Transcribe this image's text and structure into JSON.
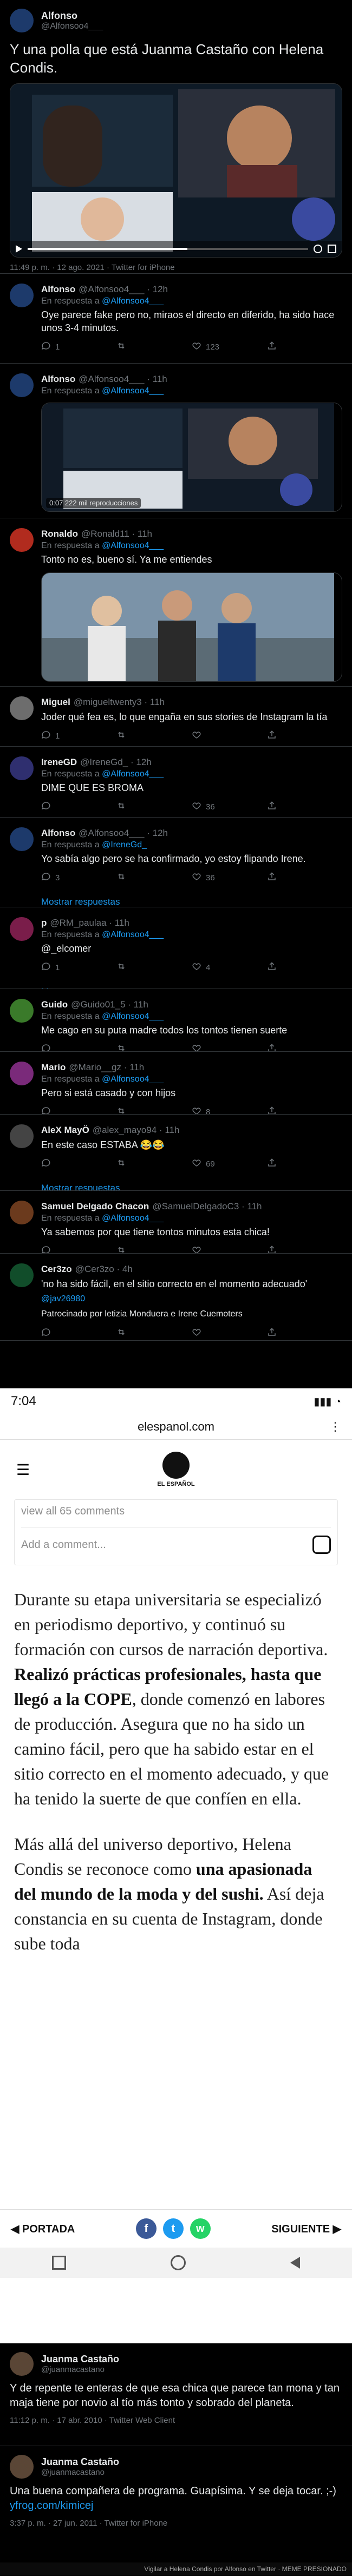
{
  "tweet_main": {
    "name": "Alfonso",
    "handle": "@Alfonsoo4___",
    "text": "Y una polla que está Juanma Castaño con Helena Condis.",
    "meta": "11:49 p. m. · 12 ago. 2021 · Twitter for iPhone",
    "video_progress": 0.57
  },
  "replies": [
    {
      "name": "Alfonso",
      "handle": "@Alfonsoo4___",
      "time": "12h",
      "reply_to": "@Alfonsoo4___",
      "text": "Oye parece fake pero no, miraos el directo en diferido, ha sido hace unos 3-4 minutos.",
      "comments": "1",
      "retweets": "",
      "likes": "123",
      "av": "#1d3a6b"
    },
    {
      "name": "Alfonso",
      "handle": "@Alfonsoo4___",
      "time": "11h",
      "reply_to": "@Alfonsoo4___",
      "text": "",
      "video_caption": "0:07   222 mil reproducciones",
      "comments": "",
      "retweets": "",
      "likes": "",
      "av": "#1d3a6b"
    },
    {
      "name": "Ronaldo",
      "handle": "@Ronald11",
      "time": "11h",
      "reply_to": "@Alfonsoo4___",
      "text": "Tonto no es, bueno sí. Ya me entiendes",
      "comments": "3",
      "retweets": "1",
      "likes": "40",
      "av": "#b12b1e"
    },
    {
      "name": "Miguel",
      "handle": "@migueltwenty3",
      "time": "11h",
      "reply_to": "",
      "text": "Joder qué fea es, lo que engaña en sus stories de Instagram la tía",
      "comments": "1",
      "retweets": "",
      "likes": "",
      "av": "#6d6d6d"
    },
    {
      "name": "IreneGD",
      "handle": "@IreneGd_",
      "time": "12h",
      "reply_to": "@Alfonsoo4___",
      "text": "DIME QUE ES BROMA",
      "comments": "",
      "retweets": "",
      "likes": "36",
      "av": "#2f2f6f"
    },
    {
      "name": "Alfonso",
      "handle": "@Alfonsoo4___",
      "time": "12h",
      "reply_to": "@IreneGd_",
      "text": "Yo sabía algo pero se ha confirmado, yo estoy flipando Irene.",
      "comments": "3",
      "retweets": "",
      "likes": "36",
      "av": "#1d3a6b",
      "show": "Mostrar respuestas"
    },
    {
      "name": "p",
      "handle": "@RM_paulaa",
      "time": "11h",
      "reply_to": "@Alfonsoo4___",
      "text": "@_elcomer",
      "comments": "1",
      "retweets": "",
      "likes": "4",
      "av": "#7a1d4a",
      "show": "Mostrar respuestas"
    },
    {
      "name": "Guido",
      "handle": "@Guido01_5",
      "time": "11h",
      "reply_to": "@Alfonsoo4___",
      "text": "Me cago en su puta madre todos los tontos tienen suerte",
      "comments": "",
      "retweets": "",
      "likes": "",
      "av": "#3a7a2a"
    },
    {
      "name": "Mario",
      "handle": "@Mario__gz",
      "time": "11h",
      "reply_to": "@Alfonsoo4___",
      "text": "Pero si está casado y con hijos",
      "comments": "",
      "retweets": "",
      "likes": "8",
      "av": "#7a2a7a"
    },
    {
      "name": "AleX MayÖ",
      "handle": "@alex_mayo94",
      "time": "11h",
      "reply_to": "",
      "text": "En este caso ESTABA 😂😂",
      "comments": "",
      "retweets": "",
      "likes": "69",
      "av": "#444",
      "show": "Mostrar respuestas"
    },
    {
      "name": "Samuel Delgado Chacon",
      "handle": "@SamuelDelgadoC3",
      "time": "11h",
      "reply_to": "@Alfonsoo4___",
      "text": "Ya sabemos por que tiene tontos minutos esta chica!",
      "comments": "",
      "retweets": "",
      "likes": "",
      "av": "#6b3a1d"
    },
    {
      "name": "Cer3zo",
      "handle": "@Cer3zo",
      "time": "4h",
      "reply_to": "",
      "text": "'no ha sido fácil, en el sitio correcto en el momento adecuado'",
      "extra": "@jav26980",
      "extra2": "Patrocinado por letizia Monduera e Irene Cuemoters",
      "av": "#114d2a"
    }
  ],
  "mobile": {
    "time": "7:04",
    "url": "elespanol.com",
    "ig_view_all": "view all 65 comments",
    "ig_add_comment": "Add a comment...",
    "logo_label": "EL ESPAÑOL",
    "p1_a": "Durante su etapa universitaria se especializó en periodismo deportivo, y continuó su formación con cursos de narración deportiva. ",
    "p1_b": "Realizó prácticas profesionales, hasta que llegó a la COPE",
    "p1_c": ", donde comenzó en labores de producción. Asegura que no ha sido un camino fácil, pero que ha sabido estar en el sitio correcto en el momento adecuado, y que ha tenido la suerte de que confíen en ella.",
    "p2_a": "Más allá del universo deportivo, Helena Condis se reconoce como ",
    "p2_b": "una apasionada del mundo de la moda y del sushi.",
    "p2_c": " Así deja constancia en su cuenta de Instagram, donde sube toda",
    "portada": "PORTADA",
    "siguiente": "SIGUIENTE"
  },
  "old_tweets": [
    {
      "name": "Juanma Castaño",
      "handle": "@juanmacastano",
      "text": "Y de repente te enteras de que esa chica que parece tan mona y tan maja tiene por novio al tío más tonto y sobrado del planeta.",
      "meta": "11:12 p. m. · 17 abr. 2010 · Twitter Web Client"
    },
    {
      "name": "Juanma Castaño",
      "handle": "@juanmacastano",
      "text_a": "Una buena compañera de programa. Guapísima. Y se deja tocar. ;-) ",
      "link": "yfrog.com/kimicej",
      "meta": "3:37 p. m. · 27 jun. 2011 · Twitter for iPhone"
    }
  ],
  "footer": "Vigilar a Helena Condis por Alfonso en Twitter · MEME PRESIONADO"
}
